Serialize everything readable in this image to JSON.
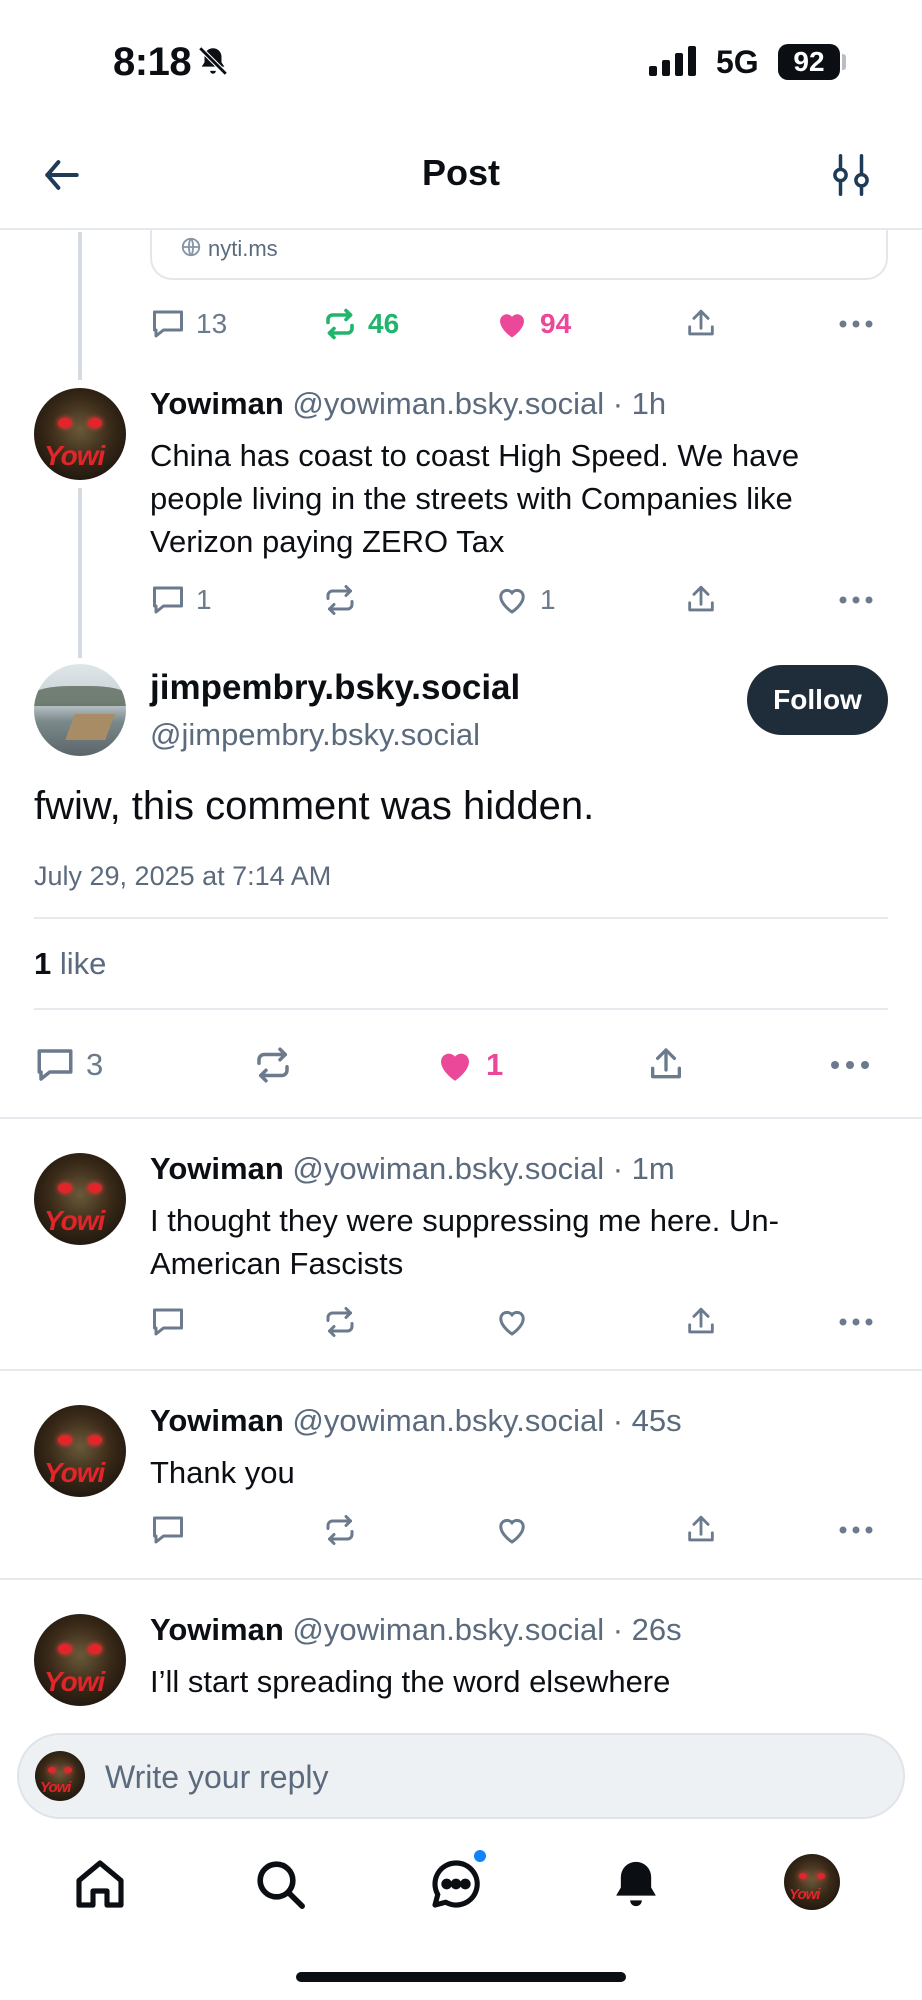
{
  "status_bar": {
    "time": "8:18",
    "network": "5G",
    "battery": "92"
  },
  "header": {
    "title": "Post"
  },
  "parent_post": {
    "link_domain": "nyti.ms",
    "replies": "13",
    "reposts": "46",
    "likes": "94",
    "accent_repost": "#1fb66b",
    "accent_like": "#ec4899"
  },
  "thread_reply": {
    "name": "Yowiman",
    "handle": "@yowiman.bsky.social",
    "time": "· 1h",
    "text": "China has coast to coast High Speed. We have people living in the streets with Companies like Verizon paying ZERO Tax",
    "replies": "1",
    "likes": "1"
  },
  "main_post": {
    "display_name": "jimpembry.bsky.social",
    "handle": "@jimpembry.bsky.social",
    "follow_label": "Follow",
    "text": "fwiw, this comment was hidden.",
    "date": "July 29, 2025 at 7:14 AM",
    "like_count": "1",
    "like_word": "like",
    "replies": "3",
    "likes": "1"
  },
  "replies": [
    {
      "name": "Yowiman",
      "handle": "@yowiman.bsky.social",
      "time": "· 1m",
      "text": "I thought they were suppressing me here. Un-American Fascists"
    },
    {
      "name": "Yowiman",
      "handle": "@yowiman.bsky.social",
      "time": "· 45s",
      "text": "Thank you"
    },
    {
      "name": "Yowiman",
      "handle": "@yowiman.bsky.social",
      "time": "· 26s",
      "text": "I’ll start spreading the word elsewhere"
    }
  ],
  "reply_bar": {
    "placeholder": "Write your reply"
  },
  "avatar_text": "Yowi",
  "icons": [
    "back-arrow-icon",
    "filter-icon",
    "globe-icon",
    "comment-icon",
    "repost-icon",
    "heart-icon",
    "share-icon",
    "more-icon",
    "home-icon",
    "search-icon",
    "chat-icon",
    "bell-icon"
  ]
}
